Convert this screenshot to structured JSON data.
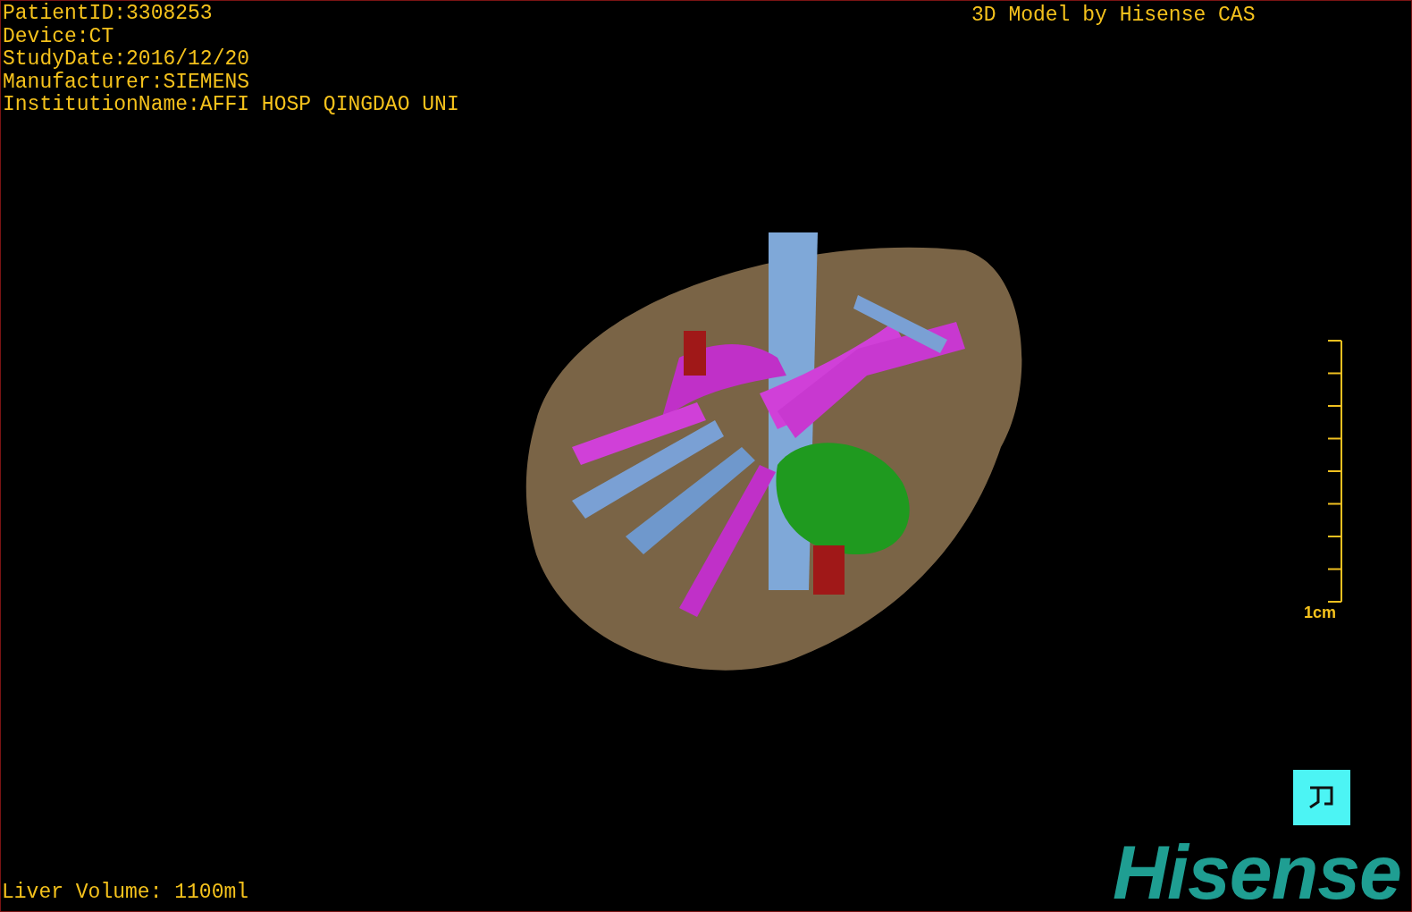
{
  "study_info": [
    "PatientID:3308253",
    "Device:CT",
    "StudyDate:2016/12/20",
    "Manufacturer:SIEMENS",
    "InstitutionName:AFFI HOSP QINGDAO UNI"
  ],
  "credit": "3D Model by Hisense CAS",
  "scale_bar": {
    "label": "1cm"
  },
  "liver_volume": "Liver Volume: 1100ml",
  "logo": "Hisense"
}
